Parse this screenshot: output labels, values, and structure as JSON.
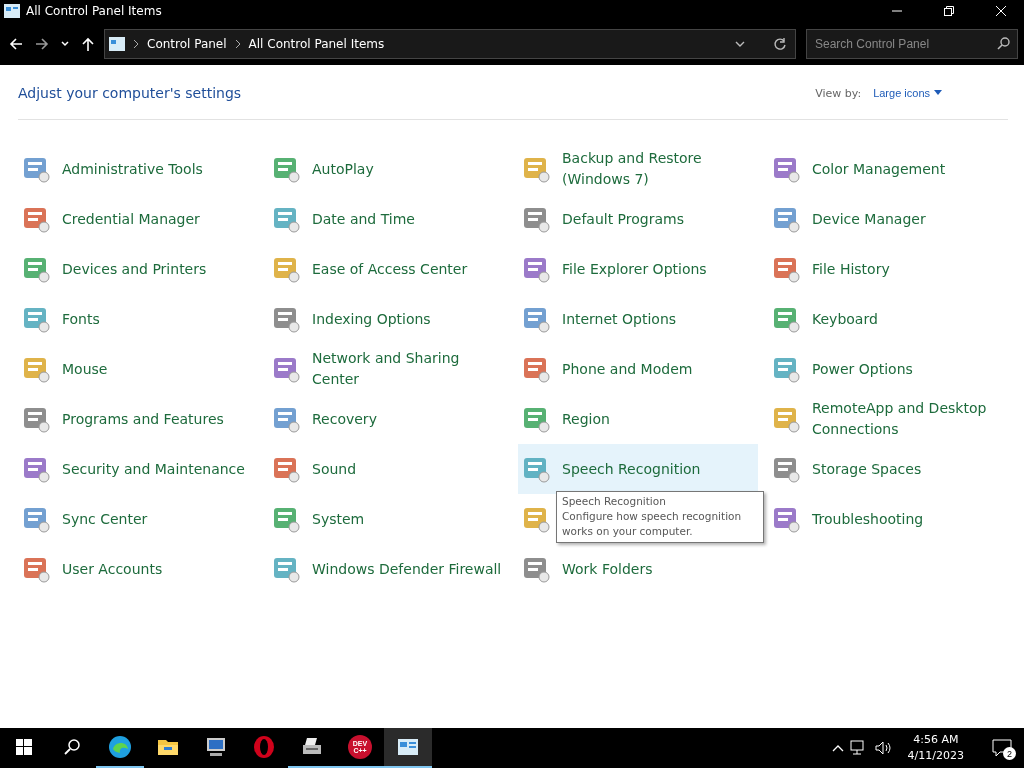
{
  "window": {
    "title": "All Control Panel Items"
  },
  "address_bar": {
    "crumbs": [
      "Control Panel",
      "All Control Panel Items"
    ]
  },
  "search": {
    "placeholder": "Search Control Panel"
  },
  "header": {
    "title": "Adjust your computer's settings",
    "view_by_label": "View by:",
    "view_by_value": "Large icons"
  },
  "items": [
    {
      "label": "Administrative Tools",
      "selected": false
    },
    {
      "label": "AutoPlay",
      "selected": false
    },
    {
      "label": "Backup and Restore (Windows 7)",
      "selected": false
    },
    {
      "label": "Color Management",
      "selected": false
    },
    {
      "label": "Credential Manager",
      "selected": false
    },
    {
      "label": "Date and Time",
      "selected": false
    },
    {
      "label": "Default Programs",
      "selected": false
    },
    {
      "label": "Device Manager",
      "selected": false
    },
    {
      "label": "Devices and Printers",
      "selected": false
    },
    {
      "label": "Ease of Access Center",
      "selected": false
    },
    {
      "label": "File Explorer Options",
      "selected": false
    },
    {
      "label": "File History",
      "selected": false
    },
    {
      "label": "Fonts",
      "selected": false
    },
    {
      "label": "Indexing Options",
      "selected": false
    },
    {
      "label": "Internet Options",
      "selected": false
    },
    {
      "label": "Keyboard",
      "selected": false
    },
    {
      "label": "Mouse",
      "selected": false
    },
    {
      "label": "Network and Sharing Center",
      "selected": false
    },
    {
      "label": "Phone and Modem",
      "selected": false
    },
    {
      "label": "Power Options",
      "selected": false
    },
    {
      "label": "Programs and Features",
      "selected": false
    },
    {
      "label": "Recovery",
      "selected": false
    },
    {
      "label": "Region",
      "selected": false
    },
    {
      "label": "RemoteApp and Desktop Connections",
      "selected": false
    },
    {
      "label": "Security and Maintenance",
      "selected": false
    },
    {
      "label": "Sound",
      "selected": false
    },
    {
      "label": "Speech Recognition",
      "selected": true
    },
    {
      "label": "Storage Spaces",
      "selected": false
    },
    {
      "label": "Sync Center",
      "selected": false
    },
    {
      "label": "System",
      "selected": false
    },
    {
      "selected": false
    },
    {
      "label": "Troubleshooting",
      "selected": false
    },
    {
      "label": "User Accounts",
      "selected": false
    },
    {
      "label": "Windows Defender Firewall",
      "selected": false
    },
    {
      "label": "Work Folders",
      "selected": false
    }
  ],
  "tooltip": {
    "title": "Speech Recognition",
    "text": "Configure how speech recognition works on your computer."
  },
  "taskbar": {
    "apps": [
      {
        "kind": "browser",
        "running": true,
        "selected": false
      },
      {
        "kind": "folder",
        "running": false,
        "selected": false
      },
      {
        "kind": "computer",
        "running": false,
        "selected": false
      },
      {
        "kind": "ring",
        "running": false,
        "selected": false
      },
      {
        "kind": "printer",
        "running": true,
        "selected": false
      },
      {
        "kind": "logo",
        "logo_text": [
          "DEV",
          "C++"
        ],
        "running": true,
        "selected": false
      },
      {
        "kind": "panel",
        "running": true,
        "selected": true
      }
    ],
    "time": "4:56 AM",
    "date": "4/11/2023",
    "notification_count": "2"
  }
}
